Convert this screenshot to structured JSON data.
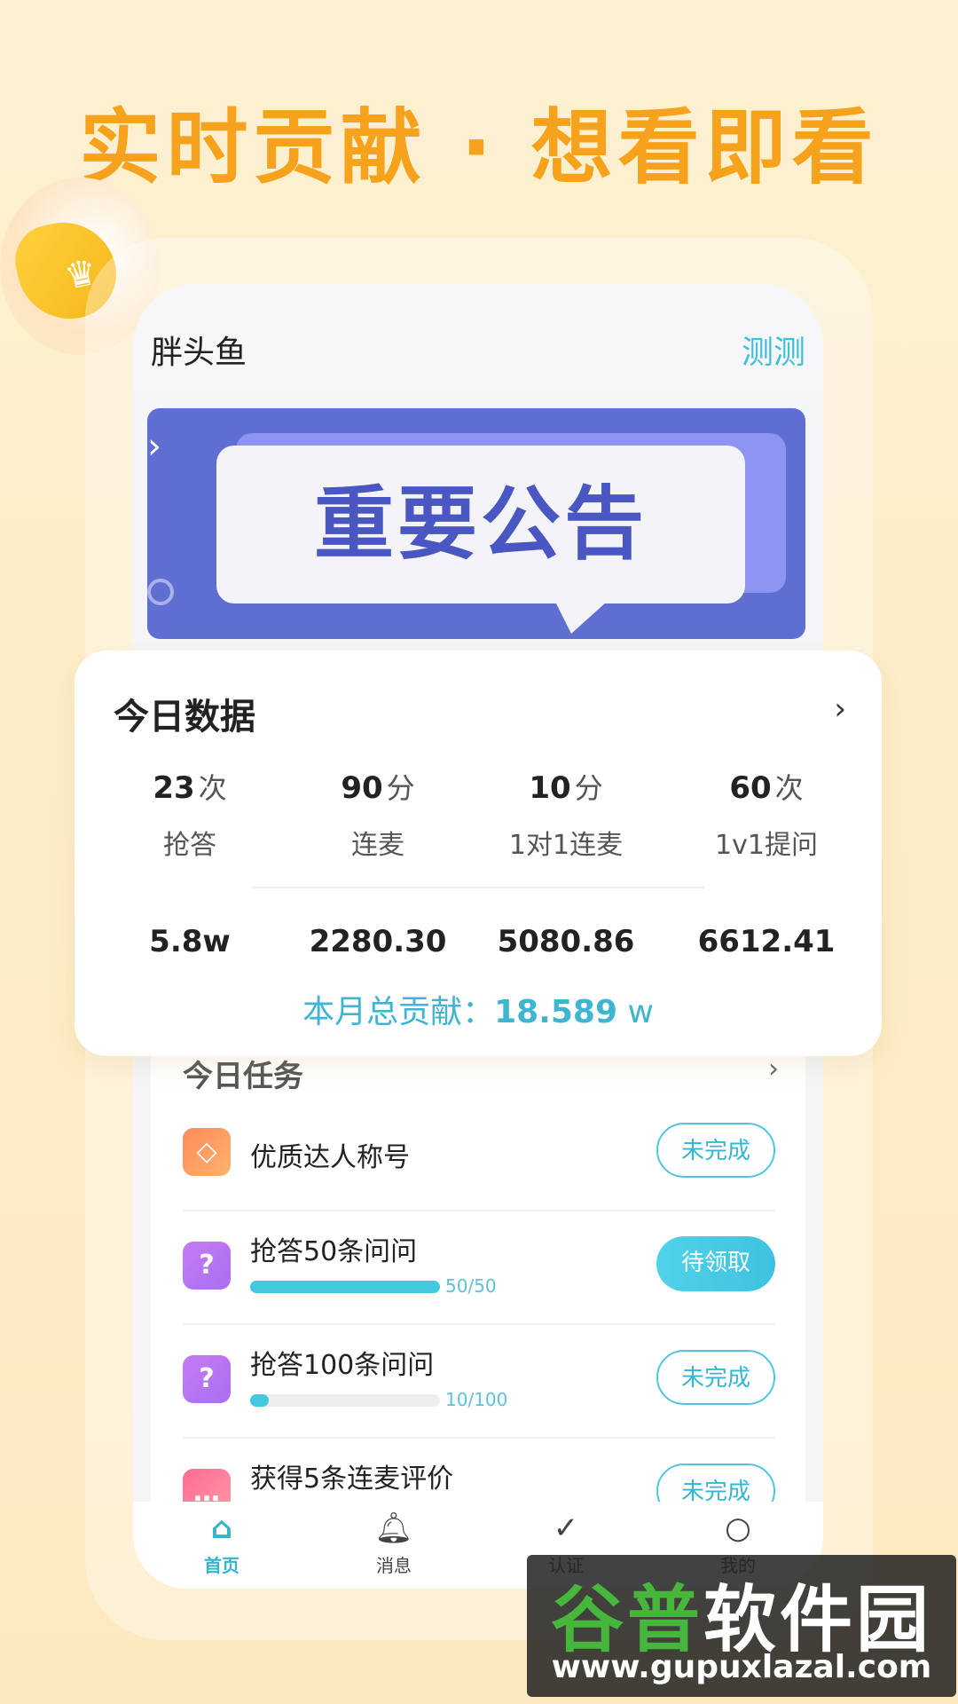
{
  "headline": "实时贡献 · 想看即看",
  "app": {
    "name": "胖头鱼",
    "action": "测测"
  },
  "banner": {
    "text": "重要公告"
  },
  "today_data": {
    "title": "今日数据",
    "metrics": [
      {
        "value": "23",
        "unit": "次",
        "label": "抢答"
      },
      {
        "value": "90",
        "unit": "分",
        "label": "连麦"
      },
      {
        "value": "10",
        "unit": "分",
        "label": "1对1连麦"
      },
      {
        "value": "60",
        "unit": "次",
        "label": "1v1提问"
      }
    ],
    "amounts": [
      "5.8w",
      "2280.30",
      "5080.86",
      "6612.41"
    ],
    "total_label": "本月总贡献：",
    "total_value": "18.589",
    "total_unit": "w"
  },
  "tasks": {
    "title": "今日任务",
    "items": [
      {
        "name": "优质达人称号",
        "status": "未完成",
        "icon": "diamond-icon",
        "color": "#ff8a5b"
      },
      {
        "name": "抢答50条问问",
        "status": "待领取",
        "progress": "50/50",
        "fraction": 1.0,
        "icon": "question-icon",
        "color": "#b577f2"
      },
      {
        "name": "抢答100条问问",
        "status": "未完成",
        "progress": "10/100",
        "fraction": 0.1,
        "icon": "question-icon",
        "color": "#b577f2"
      },
      {
        "name": "获得5条连麦评价",
        "status": "未完成",
        "icon": "chat-icon",
        "color": "#ff6b8f"
      }
    ]
  },
  "tabbar": {
    "items": [
      {
        "label": "首页",
        "icon": "home-icon",
        "active": true
      },
      {
        "label": "消息",
        "icon": "bell-icon",
        "active": false
      },
      {
        "label": "认证",
        "icon": "badge-check-icon",
        "active": false
      },
      {
        "label": "我的",
        "icon": "user-icon",
        "active": false
      }
    ]
  },
  "watermark": {
    "title_a": "谷普",
    "title_b": "软件园",
    "url": "www.gupuxlazal.com"
  },
  "colors": {
    "accent": "#3fb5d2",
    "headline": "#f7a21c",
    "banner": "#5f6fd1"
  }
}
